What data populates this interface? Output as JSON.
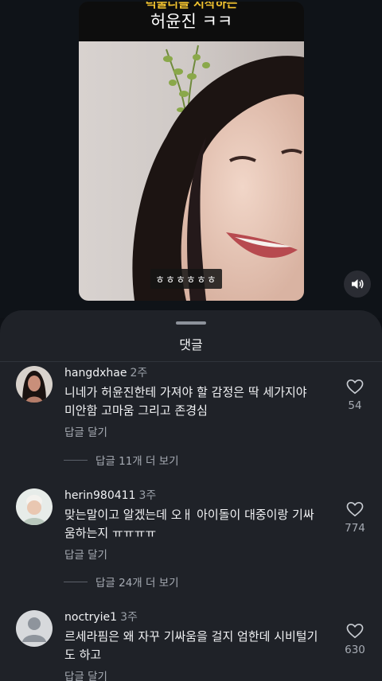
{
  "video": {
    "caption_line1": "럭물디를 시작하는",
    "caption_line2": "허윤진 ㅋㅋ",
    "subtitle": "ㅎㅎㅎㅎㅎㅎ",
    "sound_icon": "speaker-icon"
  },
  "sheet": {
    "title": "댓글"
  },
  "comments": [
    {
      "username": "hangdxhae",
      "time": "2주",
      "text": "니네가 허윤진한테 가져야 할 감정은 딱 세가지야 미안함 고마움 그리고 존경심",
      "reply_label": "답글 달기",
      "likes": "54",
      "view_replies": "답글 11개 더 보기"
    },
    {
      "username": "herin980411",
      "time": "3주",
      "text": "맞는말이고 알겠는데 오ㅐ 아이돌이 대중이랑 기싸움하는지 ㅠㅠㅠㅠ",
      "reply_label": "답글 달기",
      "likes": "774",
      "view_replies": "답글 24개 더 보기"
    },
    {
      "username": "noctryie1",
      "time": "3주",
      "text": "르세라핌은 왜 자꾸 기싸움을 걸지 엄한데 시비털기도 하고",
      "reply_label": "답글 달기",
      "likes": "630"
    }
  ],
  "colors": {
    "background": "#0e1116",
    "sheet": "#1f2228",
    "muted_text": "#a7acb4",
    "caption_yellow": "#f4c430"
  }
}
